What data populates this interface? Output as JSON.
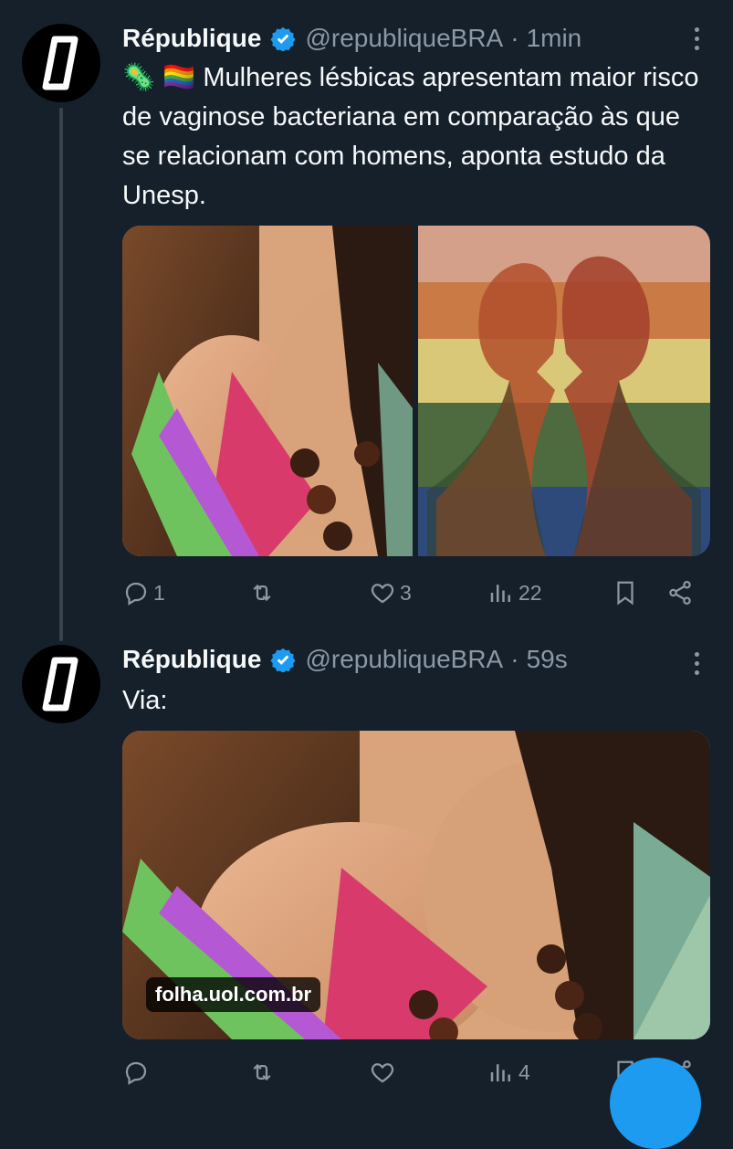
{
  "tweets": [
    {
      "name": "République",
      "handle": "@republiqueBRA",
      "time": "1min",
      "emoji": "🦠 🏳️‍🌈",
      "text": "Mulheres lésbicas apresentam maior risco de vaginose bacteriana em comparação às que se relacionam com homens, aponta estudo da Unesp.",
      "stats": {
        "replies": "1",
        "retweets": "",
        "likes": "3",
        "views": "22"
      }
    },
    {
      "name": "République",
      "handle": "@republiqueBRA",
      "time": "59s",
      "text": "Via:",
      "link_domain": "folha.uol.com.br",
      "stats": {
        "replies": "",
        "retweets": "",
        "likes": "",
        "views": "4"
      }
    }
  ],
  "colors": {
    "background": "#15202b",
    "muted": "#8b98a5",
    "verified": "#1d9bf0",
    "accent": "#1d9bf0"
  },
  "icons": [
    "verified-badge-icon",
    "more-icon",
    "reply-icon",
    "retweet-icon",
    "like-icon",
    "views-icon",
    "bookmark-icon",
    "share-icon"
  ]
}
